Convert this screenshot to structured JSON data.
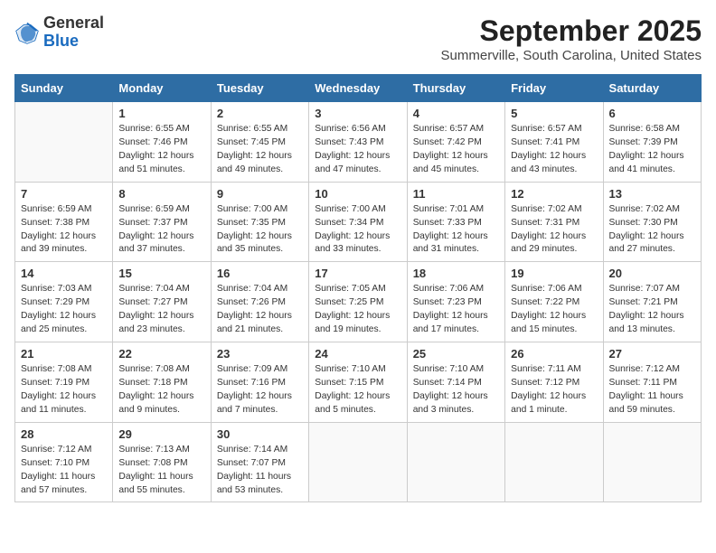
{
  "header": {
    "logo_general": "General",
    "logo_blue": "Blue",
    "month_title": "September 2025",
    "location": "Summerville, South Carolina, United States"
  },
  "weekdays": [
    "Sunday",
    "Monday",
    "Tuesday",
    "Wednesday",
    "Thursday",
    "Friday",
    "Saturday"
  ],
  "weeks": [
    [
      {
        "day": "",
        "info": ""
      },
      {
        "day": "1",
        "info": "Sunrise: 6:55 AM\nSunset: 7:46 PM\nDaylight: 12 hours\nand 51 minutes."
      },
      {
        "day": "2",
        "info": "Sunrise: 6:55 AM\nSunset: 7:45 PM\nDaylight: 12 hours\nand 49 minutes."
      },
      {
        "day": "3",
        "info": "Sunrise: 6:56 AM\nSunset: 7:43 PM\nDaylight: 12 hours\nand 47 minutes."
      },
      {
        "day": "4",
        "info": "Sunrise: 6:57 AM\nSunset: 7:42 PM\nDaylight: 12 hours\nand 45 minutes."
      },
      {
        "day": "5",
        "info": "Sunrise: 6:57 AM\nSunset: 7:41 PM\nDaylight: 12 hours\nand 43 minutes."
      },
      {
        "day": "6",
        "info": "Sunrise: 6:58 AM\nSunset: 7:39 PM\nDaylight: 12 hours\nand 41 minutes."
      }
    ],
    [
      {
        "day": "7",
        "info": "Sunrise: 6:59 AM\nSunset: 7:38 PM\nDaylight: 12 hours\nand 39 minutes."
      },
      {
        "day": "8",
        "info": "Sunrise: 6:59 AM\nSunset: 7:37 PM\nDaylight: 12 hours\nand 37 minutes."
      },
      {
        "day": "9",
        "info": "Sunrise: 7:00 AM\nSunset: 7:35 PM\nDaylight: 12 hours\nand 35 minutes."
      },
      {
        "day": "10",
        "info": "Sunrise: 7:00 AM\nSunset: 7:34 PM\nDaylight: 12 hours\nand 33 minutes."
      },
      {
        "day": "11",
        "info": "Sunrise: 7:01 AM\nSunset: 7:33 PM\nDaylight: 12 hours\nand 31 minutes."
      },
      {
        "day": "12",
        "info": "Sunrise: 7:02 AM\nSunset: 7:31 PM\nDaylight: 12 hours\nand 29 minutes."
      },
      {
        "day": "13",
        "info": "Sunrise: 7:02 AM\nSunset: 7:30 PM\nDaylight: 12 hours\nand 27 minutes."
      }
    ],
    [
      {
        "day": "14",
        "info": "Sunrise: 7:03 AM\nSunset: 7:29 PM\nDaylight: 12 hours\nand 25 minutes."
      },
      {
        "day": "15",
        "info": "Sunrise: 7:04 AM\nSunset: 7:27 PM\nDaylight: 12 hours\nand 23 minutes."
      },
      {
        "day": "16",
        "info": "Sunrise: 7:04 AM\nSunset: 7:26 PM\nDaylight: 12 hours\nand 21 minutes."
      },
      {
        "day": "17",
        "info": "Sunrise: 7:05 AM\nSunset: 7:25 PM\nDaylight: 12 hours\nand 19 minutes."
      },
      {
        "day": "18",
        "info": "Sunrise: 7:06 AM\nSunset: 7:23 PM\nDaylight: 12 hours\nand 17 minutes."
      },
      {
        "day": "19",
        "info": "Sunrise: 7:06 AM\nSunset: 7:22 PM\nDaylight: 12 hours\nand 15 minutes."
      },
      {
        "day": "20",
        "info": "Sunrise: 7:07 AM\nSunset: 7:21 PM\nDaylight: 12 hours\nand 13 minutes."
      }
    ],
    [
      {
        "day": "21",
        "info": "Sunrise: 7:08 AM\nSunset: 7:19 PM\nDaylight: 12 hours\nand 11 minutes."
      },
      {
        "day": "22",
        "info": "Sunrise: 7:08 AM\nSunset: 7:18 PM\nDaylight: 12 hours\nand 9 minutes."
      },
      {
        "day": "23",
        "info": "Sunrise: 7:09 AM\nSunset: 7:16 PM\nDaylight: 12 hours\nand 7 minutes."
      },
      {
        "day": "24",
        "info": "Sunrise: 7:10 AM\nSunset: 7:15 PM\nDaylight: 12 hours\nand 5 minutes."
      },
      {
        "day": "25",
        "info": "Sunrise: 7:10 AM\nSunset: 7:14 PM\nDaylight: 12 hours\nand 3 minutes."
      },
      {
        "day": "26",
        "info": "Sunrise: 7:11 AM\nSunset: 7:12 PM\nDaylight: 12 hours\nand 1 minute."
      },
      {
        "day": "27",
        "info": "Sunrise: 7:12 AM\nSunset: 7:11 PM\nDaylight: 11 hours\nand 59 minutes."
      }
    ],
    [
      {
        "day": "28",
        "info": "Sunrise: 7:12 AM\nSunset: 7:10 PM\nDaylight: 11 hours\nand 57 minutes."
      },
      {
        "day": "29",
        "info": "Sunrise: 7:13 AM\nSunset: 7:08 PM\nDaylight: 11 hours\nand 55 minutes."
      },
      {
        "day": "30",
        "info": "Sunrise: 7:14 AM\nSunset: 7:07 PM\nDaylight: 11 hours\nand 53 minutes."
      },
      {
        "day": "",
        "info": ""
      },
      {
        "day": "",
        "info": ""
      },
      {
        "day": "",
        "info": ""
      },
      {
        "day": "",
        "info": ""
      }
    ]
  ]
}
